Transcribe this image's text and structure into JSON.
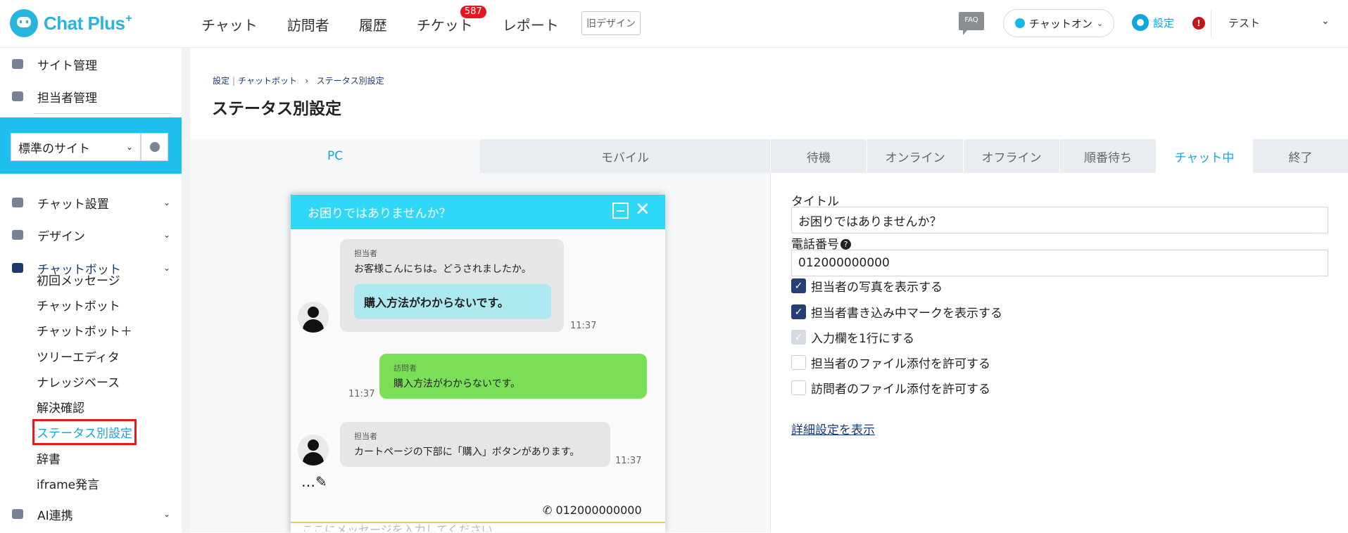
{
  "header": {
    "logo_text": "Chat Plus",
    "logo_plus": "+",
    "nav": [
      {
        "label": "チャット"
      },
      {
        "label": "訪問者"
      },
      {
        "label": "履歴"
      },
      {
        "label": "チケット",
        "badge": "587"
      },
      {
        "label": "レポート"
      }
    ],
    "old_design": "旧デザイン",
    "faq": "FAQ",
    "chat_status": "チャットオン",
    "settings": "設定",
    "alert": "!",
    "user_name": "テスト"
  },
  "sidebar": {
    "top_items": [
      {
        "label": "サイト管理"
      },
      {
        "label": "担当者管理"
      }
    ],
    "site_select": "標準のサイト",
    "sections": [
      {
        "label": "チャット設置"
      },
      {
        "label": "デザイン"
      },
      {
        "label": "チャットボット"
      }
    ],
    "sub_items": [
      {
        "label": "初回メッセージ"
      },
      {
        "label": "チャットボット"
      },
      {
        "label": "チャットボット＋"
      },
      {
        "label": "ツリーエディタ"
      },
      {
        "label": "ナレッジベース"
      },
      {
        "label": "解決確認"
      },
      {
        "label": "ステータス別設定"
      },
      {
        "label": "辞書"
      },
      {
        "label": "iframe発言"
      }
    ],
    "ai_section": "AI連携"
  },
  "breadcrumb": {
    "root": "設定",
    "sep": "|",
    "parent": "チャットボット",
    "arrow": "›",
    "current": "ステータス別設定"
  },
  "page_title": "ステータス別設定",
  "device_tabs": [
    {
      "label": "PC",
      "active": true
    },
    {
      "label": "モバイル",
      "active": false
    }
  ],
  "status_tabs": [
    {
      "label": "待機"
    },
    {
      "label": "オンライン"
    },
    {
      "label": "オフライン"
    },
    {
      "label": "順番待ち"
    },
    {
      "label": "チャット中",
      "active": true
    },
    {
      "label": "終了"
    }
  ],
  "form": {
    "title_label": "タイトル",
    "title_value": "お困りではありませんか？",
    "phone_label": "電話番号",
    "phone_help": "?",
    "phone_value": "012000000000",
    "checkboxes": [
      {
        "label": "担当者の写真を表示する",
        "state": "checked"
      },
      {
        "label": "担当者書き込み中マークを表示する",
        "state": "checked"
      },
      {
        "label": "入力欄を1行にする",
        "state": "disabled-checked"
      },
      {
        "label": "担当者のファイル添付を許可する",
        "state": "unchecked"
      },
      {
        "label": "訪問者のファイル添付を許可する",
        "state": "unchecked"
      }
    ],
    "advanced_link": "詳細設定を表示"
  },
  "preview": {
    "title": "お困りではありませんか？",
    "messages": [
      {
        "who": "担当者",
        "text": "お客様こんにちは。どうされましたか。",
        "choice": "購入方法がわからないです。",
        "time": "11:37"
      },
      {
        "who": "訪問者",
        "text": "購入方法がわからないです。",
        "time": "11:37"
      },
      {
        "who": "担当者",
        "text": "カートページの下部に「購入」ボタンがあります。",
        "time": "11:37"
      }
    ],
    "typing": "…✎",
    "phone": "012000000000",
    "input_placeholder": "ここにメッセージを入力してください"
  }
}
